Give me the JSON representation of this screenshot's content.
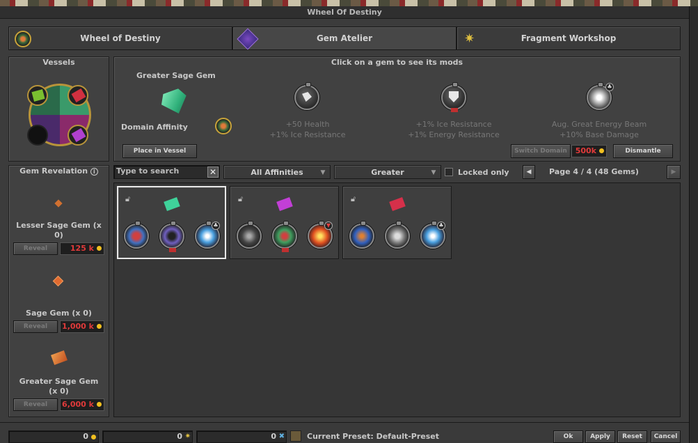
{
  "window": {
    "title": "Wheel Of Destiny"
  },
  "tabs": [
    {
      "label": "Wheel of Destiny",
      "icon": "wheel-icon"
    },
    {
      "label": "Gem Atelier",
      "icon": "gem-atelier-icon"
    },
    {
      "label": "Fragment Workshop",
      "icon": "fragment-icon"
    }
  ],
  "vessels": {
    "title": "Vessels"
  },
  "detail": {
    "header": "Click on a gem to see its mods",
    "gem_name": "Greater Sage Gem",
    "domain_label": "Domain Affinity",
    "place_button": "Place in Vessel",
    "mods": [
      {
        "line1": "+50 Health",
        "line2": "+1% Ice Resistance",
        "icon": "fist-icon"
      },
      {
        "line1": "+1% Ice Resistance",
        "line2": "+1% Energy Resistance",
        "icon": "shield-icon"
      },
      {
        "line1": "Aug. Great Energy Beam",
        "line2": "+10% Base Damage",
        "icon": "energy-beam-icon"
      }
    ],
    "switch_domain_button": "Switch Domain",
    "switch_price": "500k",
    "dismantle_button": "Dismantle"
  },
  "revelation": {
    "title": "Gem Revelation",
    "reveal_label": "Reveal",
    "gems": [
      {
        "name": "Lesser Sage Gem (x 0)",
        "price": "125 k"
      },
      {
        "name": "Sage Gem (x 0)",
        "price": "1,000 k"
      },
      {
        "name": "Greater Sage Gem (x 0)",
        "price": "6,000 k"
      }
    ]
  },
  "filters": {
    "search_placeholder": "Type to search",
    "affinity": "All Affinities",
    "quality": "Greater",
    "locked_only": "Locked only",
    "page_info": "Page 4 / 4 (48 Gems)"
  },
  "gems_list": [
    {
      "color": "#3fd29a",
      "selected": true
    },
    {
      "color": "#c23fd6",
      "selected": false
    },
    {
      "color": "#d6304a",
      "selected": false
    }
  ],
  "footer": {
    "counter1": "0",
    "counter2": "0",
    "counter3": "0",
    "preset": "Current Preset: Default-Preset",
    "ok": "Ok",
    "apply": "Apply",
    "reset": "Reset",
    "cancel": "Cancel"
  },
  "colors": {
    "price_red": "#e03a3a",
    "coin_gold": "#f2c020"
  }
}
